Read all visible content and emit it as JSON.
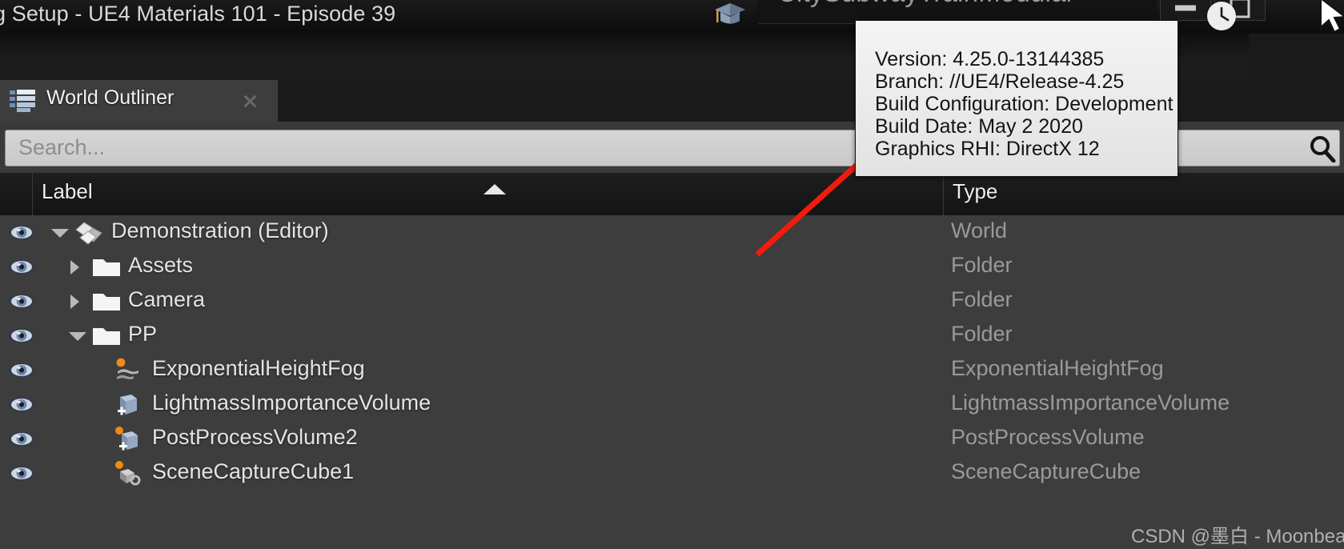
{
  "titlebar": {
    "window_title": "g Setup - UE4 Materials 101 - Episode 39",
    "document_tab": "CitySubwayTrainModular",
    "cap_icon": "graduation-cap-icon",
    "minimize_label": "",
    "maximize_label": "",
    "clock_icon": "clock-icon",
    "cursor_icon": "mouse-cursor-icon"
  },
  "tooltip": {
    "lines": [
      "Version: 4.25.0-13144385",
      "Branch: //UE4/Release-4.25",
      "Build Configuration: Development",
      "Build Date: May  2 2020",
      "Graphics RHI: DirectX 12"
    ]
  },
  "panel": {
    "tab_label": "World Outliner",
    "tab_icon": "list-lines-icon",
    "close_icon": "close-icon"
  },
  "search": {
    "placeholder": "Search...",
    "value": "",
    "icon": "search-icon"
  },
  "columns": {
    "label": "Label",
    "type": "Type",
    "sort_direction": "ascending"
  },
  "tree": {
    "rows": [
      {
        "label": "Demonstration (Editor)",
        "type": "World",
        "indent": 0,
        "twisty": "open",
        "icon": "world-icon",
        "visibility_icon": "eye-icon"
      },
      {
        "label": "Assets",
        "type": "Folder",
        "indent": 1,
        "twisty": "closed",
        "icon": "folder-icon",
        "visibility_icon": "eye-icon"
      },
      {
        "label": "Camera",
        "type": "Folder",
        "indent": 1,
        "twisty": "closed",
        "icon": "folder-icon",
        "visibility_icon": "eye-icon"
      },
      {
        "label": "PP",
        "type": "Folder",
        "indent": 1,
        "twisty": "open",
        "icon": "folder-icon",
        "visibility_icon": "eye-icon"
      },
      {
        "label": "ExponentialHeightFog",
        "type": "ExponentialHeightFog",
        "indent": 2,
        "twisty": "none",
        "icon": "fog-actor-icon",
        "visibility_icon": "eye-icon"
      },
      {
        "label": "LightmassImportanceVolume",
        "type": "LightmassImportanceVolume",
        "indent": 2,
        "twisty": "none",
        "icon": "volume-actor-icon",
        "visibility_icon": "eye-icon"
      },
      {
        "label": "PostProcessVolume2",
        "type": "PostProcessVolume",
        "indent": 2,
        "twisty": "none",
        "icon": "volume-actor-icon",
        "visibility_icon": "eye-icon"
      },
      {
        "label": "SceneCaptureCube1",
        "type": "SceneCaptureCube",
        "indent": 2,
        "twisty": "none",
        "icon": "scene-capture-icon",
        "visibility_icon": "eye-icon"
      }
    ]
  },
  "annotation": {
    "arrow_color": "#f41a0c",
    "arrow_target": "Graphics RHI: DirectX 12"
  },
  "watermark": "CSDN @墨白 - Moonbeam",
  "colors": {
    "panel_bg": "#3d3d3d",
    "header_bg": "#1b1b1b",
    "tooltip_bg": "#ededed",
    "accent_orange": "#f08a12"
  }
}
